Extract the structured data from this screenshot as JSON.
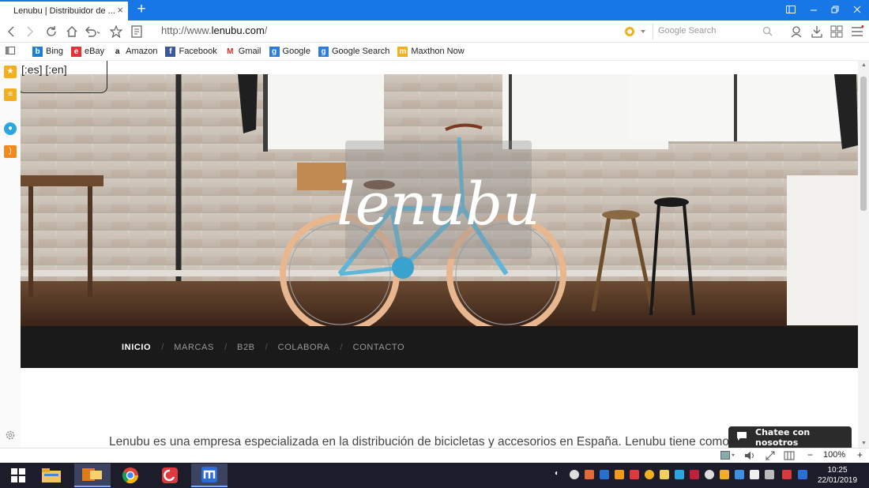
{
  "browser": {
    "tab_title": "Lenubu | Distribuidor de ...",
    "tab_close": "×",
    "new_tab": "+",
    "url_prefix": "http://www.",
    "url_domain": "lenubu.com",
    "url_suffix": "/",
    "search_placeholder": "Google Search"
  },
  "bookmarks": [
    {
      "label": "Bing",
      "icon": "bing-icon",
      "color": "#1a7fd4"
    },
    {
      "label": "eBay",
      "icon": "ebay-icon",
      "color": "#e53238"
    },
    {
      "label": "Amazon",
      "icon": "amazon-icon",
      "color": "#111111"
    },
    {
      "label": "Facebook",
      "icon": "facebook-icon",
      "color": "#3b5998"
    },
    {
      "label": "Gmail",
      "icon": "gmail-icon",
      "color": "#d93025"
    },
    {
      "label": "Google",
      "icon": "google-icon",
      "color": "#2d7ce0"
    },
    {
      "label": "Google Search",
      "icon": "google-search-icon",
      "color": "#2d7ce0"
    },
    {
      "label": "Maxthon Now",
      "icon": "maxthon-now-icon",
      "color": "#f2b01e"
    }
  ],
  "page": {
    "lang_switch": "[:es] [:en]",
    "logo_text": "lenubu",
    "menu": [
      "INICIO",
      "MARCAS",
      "B2B",
      "COLABORA",
      "CONTACTO"
    ],
    "menu_separator": "/",
    "intro_text": "Lenubu es una empresa especializada en la distribución de bicicletas y accesorios en España. Lenubu tiene como filos",
    "chat_label": "Chatee con nosotros"
  },
  "statusbar": {
    "zoom": "100%",
    "zoom_minus": "−",
    "zoom_plus": "+"
  },
  "taskbar": {
    "time": "10:25",
    "date": "22/01/2019"
  },
  "colors": {
    "tabbar": "#1877e6",
    "menu_bg": "#1a1a1a",
    "taskbar": "#1c1c2a"
  }
}
